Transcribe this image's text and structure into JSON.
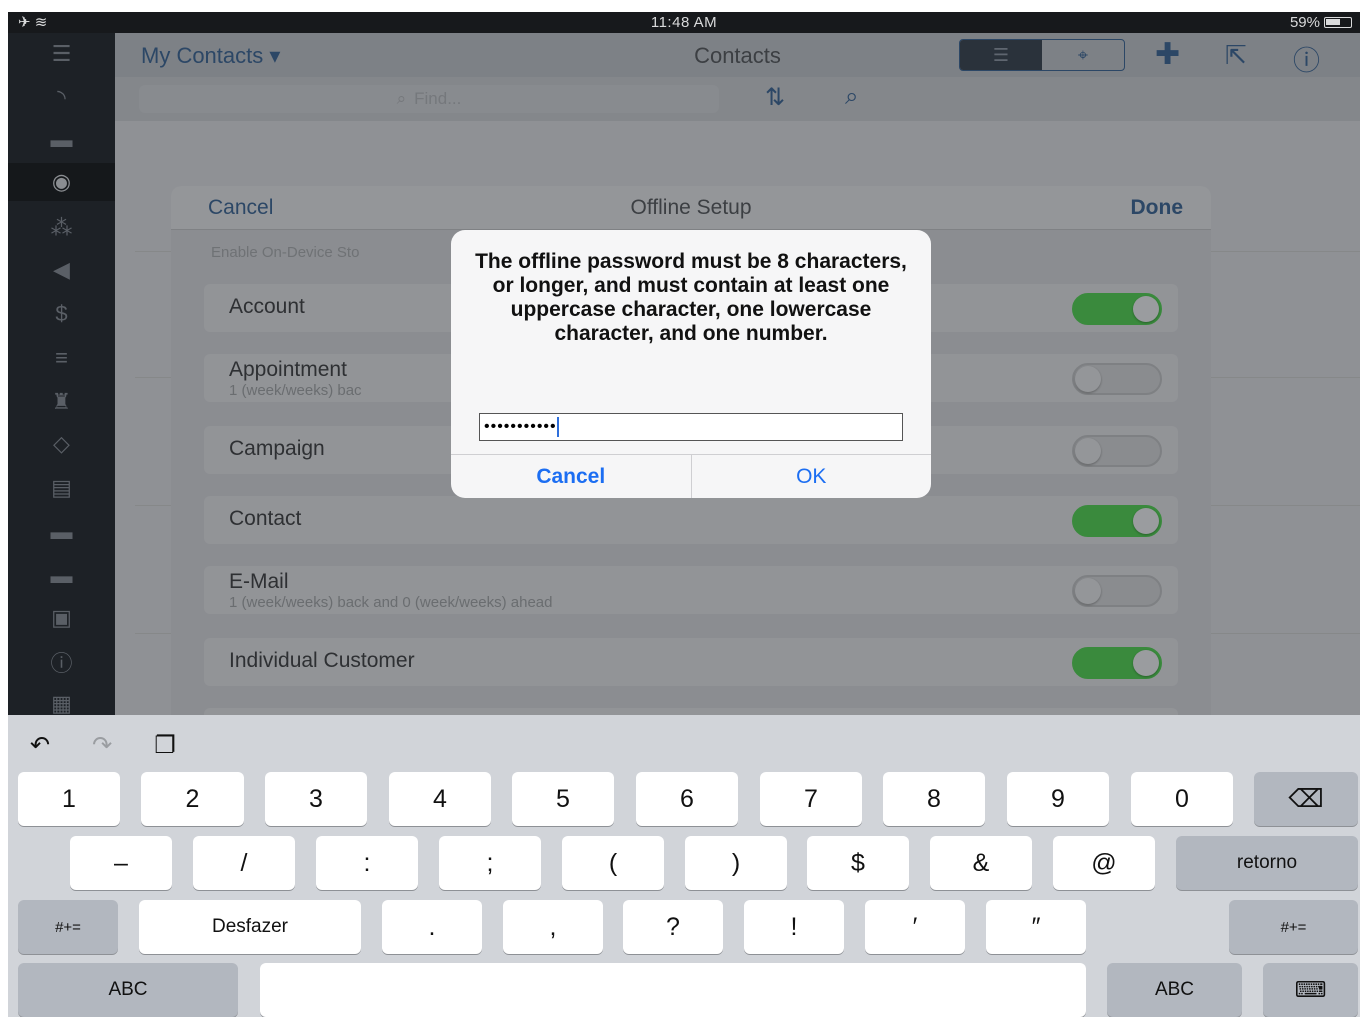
{
  "status_bar": {
    "time": "11:48 AM",
    "battery": "59%"
  },
  "nav": {
    "menu": "My Contacts ▾",
    "title": "Contacts"
  },
  "search": {
    "placeholder": "Find..."
  },
  "sheet": {
    "cancel": "Cancel",
    "title": "Offline Setup",
    "done": "Done",
    "section": "Enable On-Device Sto",
    "rows": [
      {
        "label": "Account",
        "sub": "",
        "on": true
      },
      {
        "label": "Appointment",
        "sub": "1 (week/weeks) bac",
        "on": false
      },
      {
        "label": "Campaign",
        "sub": "",
        "on": false
      },
      {
        "label": "Contact",
        "sub": "",
        "on": true
      },
      {
        "label": "E-Mail",
        "sub": "1 (week/weeks) back and 0 (week/weeks) ahead",
        "on": false
      },
      {
        "label": "Individual Customer",
        "sub": "",
        "on": true
      }
    ]
  },
  "alert": {
    "message": "The offline password must be 8 characters, or longer, and must contain at least one uppercase character, one lowercase character, and one number.",
    "password_mask": "•••••••••••",
    "cancel": "Cancel",
    "ok": "OK"
  },
  "keyboard": {
    "row1": [
      "1",
      "2",
      "3",
      "4",
      "5",
      "6",
      "7",
      "8",
      "9",
      "0"
    ],
    "row2": [
      "–",
      "/",
      ":",
      ";",
      "(",
      ")",
      "$",
      "&",
      "@"
    ],
    "return": "retorno",
    "shift": "#+=",
    "undo": "Desfazer",
    "row3": [
      ".",
      ",",
      "?",
      "!",
      "′",
      "″"
    ],
    "abc": "ABC",
    "hide": "keyboard-hide"
  }
}
